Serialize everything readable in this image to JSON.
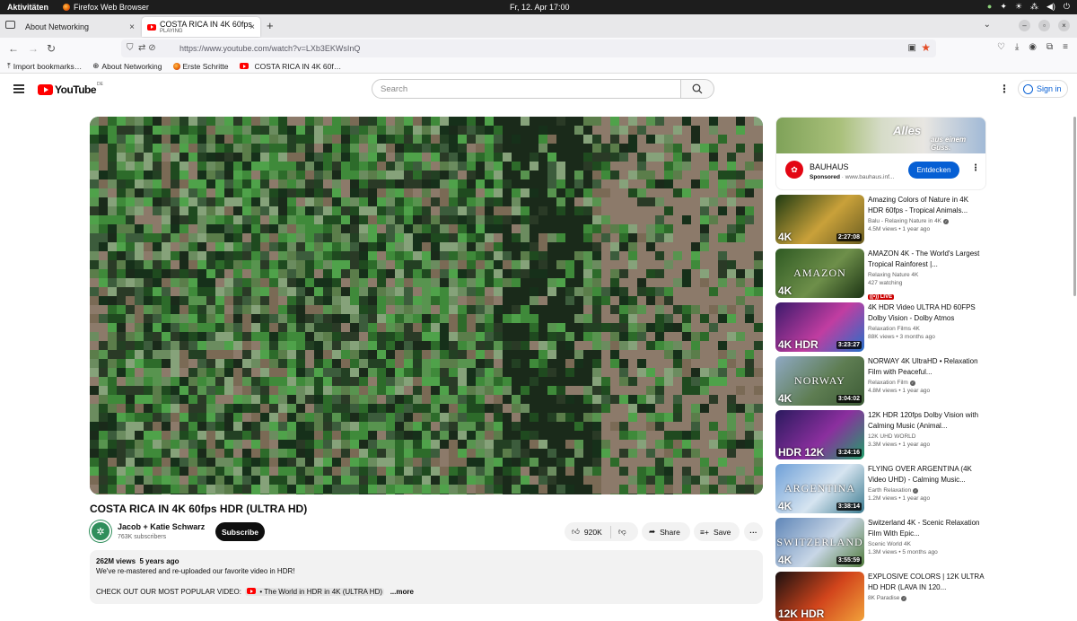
{
  "system_bar": {
    "activities": "Aktivitäten",
    "app_name": "Firefox Web Browser",
    "datetime": "Fr, 12. Apr 17:00"
  },
  "browser": {
    "tabs": [
      {
        "label": "About Networking",
        "subtitle": ""
      },
      {
        "label": "COSTA RICA IN 4K 60fps",
        "subtitle": "PLAYING"
      }
    ],
    "url": "https://www.youtube.com/watch?v=LXb3EKWsInQ",
    "bookmarks": [
      "Import bookmarks…",
      "About Networking",
      "Erste Schritte",
      "COSTA RICA IN 4K 60f…"
    ]
  },
  "youtube": {
    "logo_text": "YouTube",
    "country_code": "DE",
    "search_placeholder": "Search",
    "sign_in": "Sign in"
  },
  "video": {
    "title": "COSTA RICA IN 4K 60fps HDR (ULTRA HD)",
    "channel": "Jacob + Katie Schwarz",
    "subscribers": "763K subscribers",
    "subscribe_label": "Subscribe",
    "likes": "920K",
    "share_label": "Share",
    "save_label": "Save",
    "views": "262M views",
    "age": "5 years ago",
    "desc_line1": "We've re-mastered and re-uploaded our favorite video in HDR!",
    "desc_line2": "CHECK OUT OUR MOST POPULAR VIDEO:",
    "desc_link": "• The World in HDR in 4K (ULTRA HD)",
    "more_label": "...more"
  },
  "ad": {
    "headline": "Alles",
    "headline2": "aus einem Guss.",
    "advertiser": "BAUHAUS",
    "sponsored": "Sponsored",
    "domain": "www.bauhaus.inf...",
    "cta": "Entdecken"
  },
  "recommendations": [
    {
      "title": "Amazing Colors of Nature in 4K HDR 60fps - Tropical Animals...",
      "channel": "Balu - Relaxing Nature in 4K",
      "verified": true,
      "views": "4.5M views",
      "age": "1 year ago",
      "duration": "2:27:08",
      "live": false,
      "tag": "4K",
      "mid": "",
      "colors": [
        "#1e3a12",
        "#c9a13a",
        "#6a5d21"
      ]
    },
    {
      "title": "AMAZON 4K - The World's Largest Tropical Rainforest |...",
      "channel": "Relaxing Nature 4K",
      "verified": false,
      "views": "427 watching",
      "age": "",
      "duration": "",
      "live": true,
      "live_label": "LIVE",
      "tag": "4K",
      "mid": "AMAZON",
      "colors": [
        "#2f5a23",
        "#6e8f4a",
        "#1c3414"
      ]
    },
    {
      "title": "4K HDR Video ULTRA HD 60FPS Dolby Vision - Dolby Atmos",
      "channel": "Relaxation Films 4K",
      "verified": false,
      "views": "88K views",
      "age": "3 months ago",
      "duration": "3:23:27",
      "live": false,
      "tag": "4K HDR",
      "mid": "",
      "colors": [
        "#3b1a6b",
        "#c13da1",
        "#2470c9"
      ]
    },
    {
      "title": "NORWAY 4K UltraHD • Relaxation Film with Peaceful...",
      "channel": "Relaxation Film",
      "verified": true,
      "views": "4.8M views",
      "age": "1 year ago",
      "duration": "3:04:02",
      "live": false,
      "tag": "4K",
      "mid": "NORWAY",
      "colors": [
        "#8fa9c4",
        "#5e7d52",
        "#3c5a35"
      ]
    },
    {
      "title": "12K HDR 120fps Dolby Vision with Calming Music (Animal...",
      "channel": "12K UHD WORLD",
      "verified": false,
      "views": "3.3M views",
      "age": "1 year ago",
      "duration": "3:24:16",
      "live": false,
      "tag": "HDR 12K",
      "mid": "",
      "colors": [
        "#2a1a5e",
        "#8b2f9e",
        "#21a06a"
      ]
    },
    {
      "title": "FLYING OVER ARGENTINA (4K Video UHD) - Calming Music...",
      "channel": "Earth Relaxation",
      "verified": true,
      "views": "1.2M views",
      "age": "1 year ago",
      "duration": "3:38:14",
      "live": false,
      "tag": "4K",
      "mid": "ARGENTINA",
      "colors": [
        "#6fa0d8",
        "#d6e4f0",
        "#3b7a8f"
      ]
    },
    {
      "title": "Switzerland 4K - Scenic Relaxation Film With Epic...",
      "channel": "Scenic World 4K",
      "verified": false,
      "views": "1.3M views",
      "age": "5 months ago",
      "duration": "3:55:59",
      "live": false,
      "tag": "4K",
      "mid": "SWITZERLAND",
      "colors": [
        "#5f86b8",
        "#c8d6e6",
        "#4f7a3a"
      ]
    },
    {
      "title": "EXPLOSIVE COLORS | 12K ULTRA HD HDR (LAVA IN 120...",
      "channel": "8K Paradise",
      "verified": true,
      "views": "",
      "age": "",
      "duration": "",
      "live": false,
      "tag": "12K HDR",
      "mid": "",
      "colors": [
        "#1a1010",
        "#d2451c",
        "#f1a13a"
      ]
    }
  ]
}
